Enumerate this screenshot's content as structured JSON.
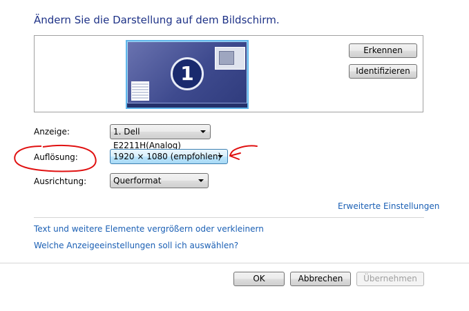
{
  "header": {
    "title": "Ändern Sie die Darstellung auf dem Bildschirm."
  },
  "preview": {
    "monitor_number": "1"
  },
  "buttons": {
    "detect": "Erkennen",
    "identify": "Identifizieren",
    "ok": "OK",
    "cancel": "Abbrechen",
    "apply": "Übernehmen"
  },
  "settings": {
    "display_label": "Anzeige:",
    "display_value": "1. Dell E2211H(Analog)",
    "resolution_label": "Auflösung:",
    "resolution_value": "1920 × 1080 (empfohlen)",
    "orientation_label": "Ausrichtung:",
    "orientation_value": "Querformat"
  },
  "links": {
    "advanced": "Erweiterte Einstellungen",
    "text_size": "Text und weitere Elemente vergrößern oder verkleinern",
    "which_settings": "Welche Anzeigeeinstellungen soll ich auswählen?"
  },
  "colors": {
    "title": "#1e3287",
    "link": "#1a5fb4",
    "annotation": "#e01010"
  }
}
